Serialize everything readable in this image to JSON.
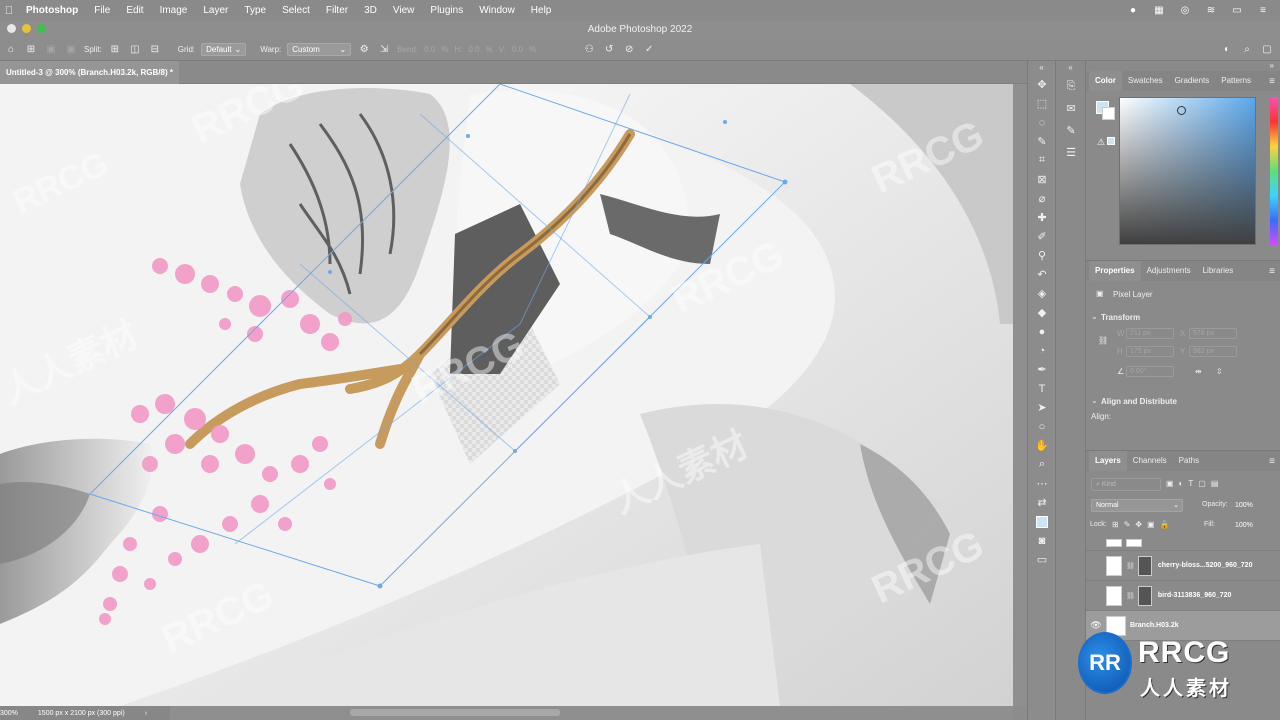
{
  "menubar": {
    "apple": "",
    "items": [
      "Photoshop",
      "File",
      "Edit",
      "Image",
      "Layer",
      "Type",
      "Select",
      "Filter",
      "3D",
      "View",
      "Plugins",
      "Window",
      "Help"
    ]
  },
  "window": {
    "title": "Adobe Photoshop 2022"
  },
  "options": {
    "split_label": "Split:",
    "grid_label": "Grid:",
    "grid_value": "Default",
    "warp_label": "Warp:",
    "warp_value": "Custom",
    "bend_label": "Bend:",
    "bend_value": "0.0",
    "bend_unit": "%",
    "h_label": "H:",
    "h_value": "0.0",
    "h_unit": "%",
    "v_label": "V:",
    "v_value": "0.0",
    "v_unit": "%"
  },
  "document": {
    "tab_title": "Untitled-3 @ 300% (Branch.H03.2k, RGB/8) *"
  },
  "status": {
    "zoom": "300%",
    "doc_info": "1500 px x 2100 px (300 ppi)"
  },
  "color_panel": {
    "tabs": [
      "Color",
      "Swatches",
      "Gradients",
      "Patterns"
    ],
    "foreground": "#cde4f2",
    "background": "#ffffff",
    "field_hue": "#5aa7ec"
  },
  "properties_panel": {
    "tabs": [
      "Properties",
      "Adjustments",
      "Libraries"
    ],
    "layer_type": "Pixel Layer",
    "transform_label": "Transform",
    "w_label": "W",
    "w_value": "211 px",
    "x_label": "X",
    "x_value": "578 px",
    "h_label": "H",
    "h_value": "175 px",
    "y_label": "Y",
    "y_value": "982 px",
    "angle_value": "0.00°",
    "align_label": "Align and Distribute",
    "align_sub": "Align:"
  },
  "layers_panel": {
    "tabs": [
      "Layers",
      "Channels",
      "Paths"
    ],
    "kind_placeholder": "Kind",
    "blend_mode": "Normal",
    "opacity_label": "Opacity:",
    "opacity_value": "100%",
    "lock_label": "Lock:",
    "fill_label": "Fill:",
    "fill_value": "100%",
    "layers": [
      {
        "name": "cherry-bloss...5200_960_720"
      },
      {
        "name": "bird-3113836_960_720"
      },
      {
        "name": "Branch.H03.2k"
      }
    ]
  },
  "watermark": {
    "text": "RRCG",
    "cn": "人人素材"
  },
  "accent_colors": {
    "transform_guide": "#6fa8e8",
    "branch": "#c79a5e",
    "blossom": "#f29ac6"
  }
}
